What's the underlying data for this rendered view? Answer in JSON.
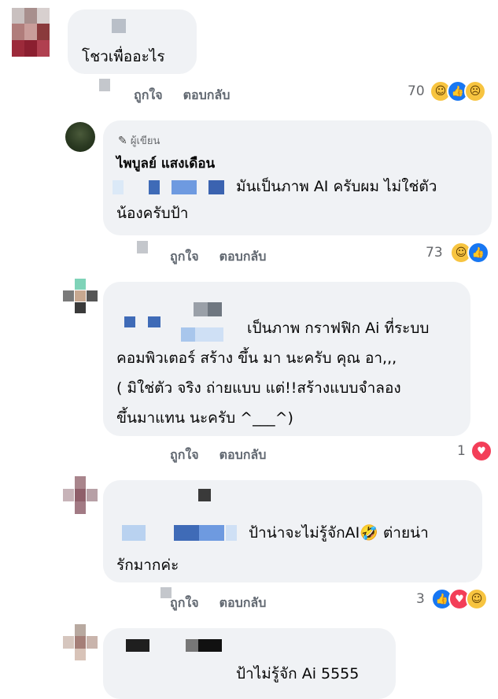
{
  "comments": [
    {
      "text_lines": [
        "โชวเพื่ออะไร"
      ],
      "like": "ถูกใจ",
      "reply": "ตอบกลับ",
      "reaction_count": "70"
    },
    {
      "author_badge": "ผู้เขียน",
      "name": "ไพบูลย์ แสงเดือน",
      "text_lines": [
        "มันเป็นภาพ AI ครับผม ไม่ใช่ตัว",
        "น้องครับป้า"
      ],
      "like": "ถูกใจ",
      "reply": "ตอบกลับ",
      "reaction_count": "73"
    },
    {
      "text_lines": [
        "เป็นภาพ กราฟฟิก Ai ที่ระบบ",
        "คอมพิวเตอร์ สร้าง ขึ้น มา นะครับ คุณ อา,,,",
        "( มิใช่ตัว จริง ถ่ายแบบ  แต่!!สร้างแบบจำลอง",
        "ขึ้นมาแทน นะครับ ^___^)"
      ],
      "like": "ถูกใจ",
      "reply": "ตอบกลับ",
      "reaction_count": "1"
    },
    {
      "text_lines": [
        "ป้าน่าจะไม่รู้จักAI🤣  ต่ายน่า",
        "รักมากค่ะ"
      ],
      "like": "ถูกใจ",
      "reply": "ตอบกลับ",
      "reaction_count": "3"
    },
    {
      "text_lines": [
        "ป้าไม่รู้จัก Ai 5555"
      ]
    }
  ],
  "colors": {
    "bubble": "#f0f2f5",
    "like_blue": "#1877f2",
    "love_red": "#f33e58",
    "haha_yellow": "#f7c440"
  }
}
